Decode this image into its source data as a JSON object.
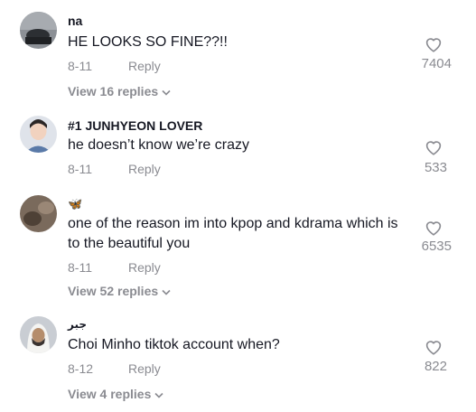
{
  "comments": [
    {
      "username": "na",
      "text": "HE LOOKS SO FINE??!!",
      "date": "8-11",
      "reply_label": "Reply",
      "likes": "7404",
      "view_replies": "View 16 replies",
      "avatar_icon": "car-photo-avatar"
    },
    {
      "username": "#1 JUNHYEON LOVER",
      "text": "he doesn’t know we’re crazy",
      "date": "8-11",
      "reply_label": "Reply",
      "likes": "533",
      "avatar_icon": "person-photo-avatar"
    },
    {
      "username": "🦋",
      "text": "one of the reason im into kpop and kdrama which is to the beautiful you",
      "date": "8-11",
      "reply_label": "Reply",
      "likes": "6535",
      "view_replies": "View 52 replies",
      "avatar_icon": "brown-photo-avatar"
    },
    {
      "username": "جبر",
      "text": "Choi Minho tiktok account when?",
      "date": "8-12",
      "reply_label": "Reply",
      "likes": "822",
      "view_replies": "View 4 replies",
      "avatar_icon": "man-photo-avatar"
    }
  ],
  "colors": {
    "text_primary": "#161823",
    "text_secondary": "#8a8b91"
  }
}
